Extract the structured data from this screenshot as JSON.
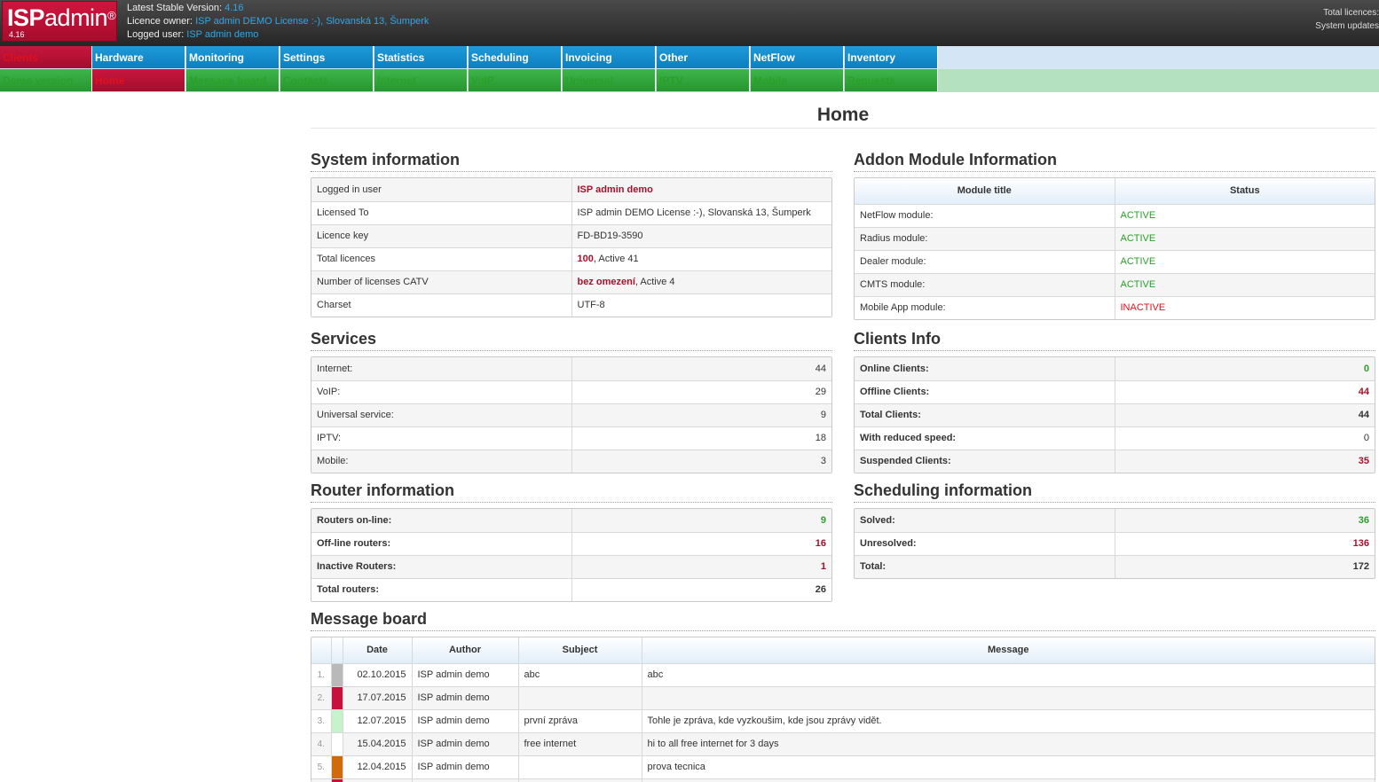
{
  "header": {
    "logo_isp": "ISP",
    "logo_admin": "admin",
    "logo_reg": "®",
    "logo_version": "4.16",
    "latest_label": "Latest Stable Version:",
    "latest_value": "4.16",
    "owner_label": "Licence owner:",
    "owner_value": "ISP admin DEMO License :-), Slovanská 13, Šumperk",
    "user_label": "Logged user:",
    "user_value": "ISP admin demo",
    "right_line1": "Total licences:",
    "right_line2": "System updates"
  },
  "nav": {
    "row1": [
      "Clients",
      "Hardware",
      "Monitoring",
      "Settings",
      "Statistics",
      "Scheduling",
      "Invoicing",
      "Other",
      "NetFlow",
      "Inventory"
    ],
    "row2": [
      "Demo version",
      "Home",
      "Message board",
      "Contacts",
      "Internet",
      "VoIP",
      "Universal",
      "IPTV",
      "Mobile",
      "Requests"
    ]
  },
  "page_title": "Home",
  "system_info": {
    "title": "System information",
    "rows": [
      {
        "label": "Logged in user",
        "value": "ISP admin demo"
      },
      {
        "label": "Licensed To",
        "value": "ISP admin DEMO License :-), Slovanská 13, Šumperk"
      },
      {
        "label": "Licence key",
        "value": "FD-BD19-3590"
      },
      {
        "label": "Total licences",
        "value_bold": "100",
        "value_rest": ", Active 41"
      },
      {
        "label": "Number of licenses CATV",
        "value_bold": "bez omezení",
        "value_rest": ", Active 4"
      },
      {
        "label": "Charset",
        "value": "UTF-8"
      }
    ]
  },
  "addon": {
    "title": "Addon Module Information",
    "col_title": "Module title",
    "col_status": "Status",
    "rows": [
      {
        "name": "NetFlow module:",
        "status": "ACTIVE"
      },
      {
        "name": "Radius module:",
        "status": "ACTIVE"
      },
      {
        "name": "Dealer module:",
        "status": "ACTIVE"
      },
      {
        "name": "CMTS module:",
        "status": "ACTIVE"
      },
      {
        "name": "Mobile App module:",
        "status": "INACTIVE"
      }
    ]
  },
  "services": {
    "title": "Services",
    "rows": [
      {
        "label": "Internet:",
        "value": "44"
      },
      {
        "label": "VoIP:",
        "value": "29"
      },
      {
        "label": "Universal service:",
        "value": "9"
      },
      {
        "label": "IPTV:",
        "value": "18"
      },
      {
        "label": "Mobile:",
        "value": "3"
      }
    ]
  },
  "clients_info": {
    "title": "Clients Info",
    "rows": [
      {
        "label": "Online Clients:",
        "value": "0"
      },
      {
        "label": "Offline Clients:",
        "value": "44"
      },
      {
        "label": "Total Clients:",
        "value": "44"
      },
      {
        "label": "With reduced speed:",
        "value": "0"
      },
      {
        "label": "Suspended Clients:",
        "value": "35"
      }
    ]
  },
  "router_info": {
    "title": "Router information",
    "rows": [
      {
        "label": "Routers on-line:",
        "value": "9"
      },
      {
        "label": "Off-line routers:",
        "value": "16"
      },
      {
        "label": "Inactive Routers:",
        "value": "1"
      },
      {
        "label": "Total routers:",
        "value": "26"
      }
    ]
  },
  "scheduling_info": {
    "title": "Scheduling information",
    "rows": [
      {
        "label": "Solved:",
        "value": "36"
      },
      {
        "label": "Unresolved:",
        "value": "136"
      },
      {
        "label": "Total:",
        "value": "172"
      }
    ]
  },
  "message_board": {
    "title": "Message board",
    "columns": [
      "Date",
      "Author",
      "Subject",
      "Message"
    ],
    "rows": [
      {
        "index": "1.",
        "color": "#b9b9b9",
        "date": "02.10.2015",
        "author": "ISP admin demo",
        "subject": "abc",
        "message": "abc"
      },
      {
        "index": "2.",
        "color": "#c8103c",
        "date": "17.07.2015",
        "author": "ISP admin demo",
        "subject": "",
        "message": ""
      },
      {
        "index": "3.",
        "color": "#c5f3cc",
        "date": "12.07.2015",
        "author": "ISP admin demo",
        "subject": "první zpráva",
        "message": "Tohle je zpráva, kde vyzkoušim, kde jsou zprávy vidět."
      },
      {
        "index": "4.",
        "color": "#ffffff",
        "date": "15.04.2015",
        "author": "ISP admin demo",
        "subject": "free internet",
        "message": "hi to all free internet for 3 days"
      },
      {
        "index": "5.",
        "color": "#d06a0c",
        "date": "12.04.2015",
        "author": "ISP admin demo",
        "subject": "",
        "message": "prova tecnica"
      }
    ]
  }
}
